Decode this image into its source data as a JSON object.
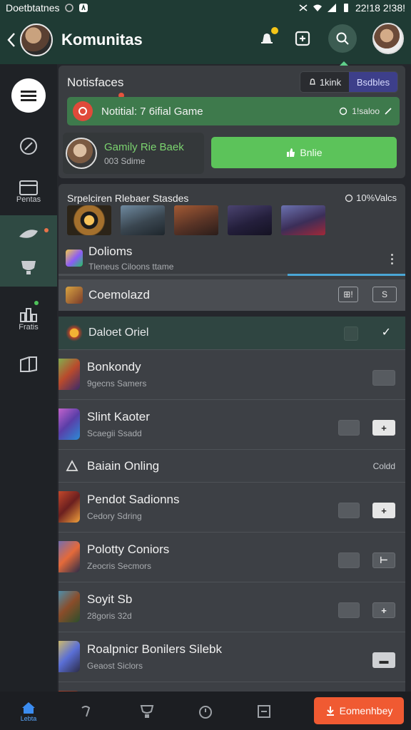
{
  "status_bar": {
    "left_text": "Doetbtatnes",
    "time": "22!18 2!38!"
  },
  "header": {
    "title": "Komunitas"
  },
  "sidebar": {
    "items": [
      {
        "label": ""
      },
      {
        "label": ""
      },
      {
        "label": "Pentas"
      },
      {
        "label": ""
      },
      {
        "label": ""
      },
      {
        "label": "Fratis"
      },
      {
        "label": ""
      }
    ]
  },
  "card1": {
    "title": "Notisfaces",
    "toggle": [
      "1kink",
      "Bsdbles"
    ],
    "notification": {
      "text": "Notitial: 7 6ifial Game",
      "right": "1!saloo"
    },
    "player": {
      "name": "Gamily Rie Baek",
      "sub": "003 Sdime"
    },
    "online_button": "Bnlie"
  },
  "card2": {
    "title": "Srpelciren Rlebaer Stasdes",
    "right": "10%Valcs",
    "domains": {
      "name": "Dolioms",
      "sub": "Tleneus Ciloons ttame"
    },
    "progress": 0.34
  },
  "command_row": {
    "name": "Coemolazd",
    "btn1": "⊞!",
    "btn2": "S"
  },
  "list": {
    "header": "Daloet Oriel",
    "rows": [
      {
        "name": "Bonkondy",
        "sub": "9gecns Samers"
      },
      {
        "name": "Slint Kaoter",
        "sub": "Scaegii Ssadd"
      },
      {
        "name": "Pendot Sadionns",
        "sub": "Cedory Sdring"
      },
      {
        "name": "Polotty Coniors",
        "sub": "Zeocris Secmors"
      },
      {
        "name": "Soyit Sb",
        "sub": "28goris 32d"
      },
      {
        "name": "Roalpnicr Bonilers Silebk",
        "sub": "Geaost Siclors"
      }
    ],
    "section": {
      "name": "Baiain Onling",
      "right": "Coldd"
    }
  },
  "bottom_bar": {
    "home_label": "Lebta",
    "cta": "Eomenhbey"
  },
  "colors": {
    "accent_green": "#5cc35a",
    "header_bg": "#1f3b34",
    "cta_orange": "#f05a32"
  }
}
